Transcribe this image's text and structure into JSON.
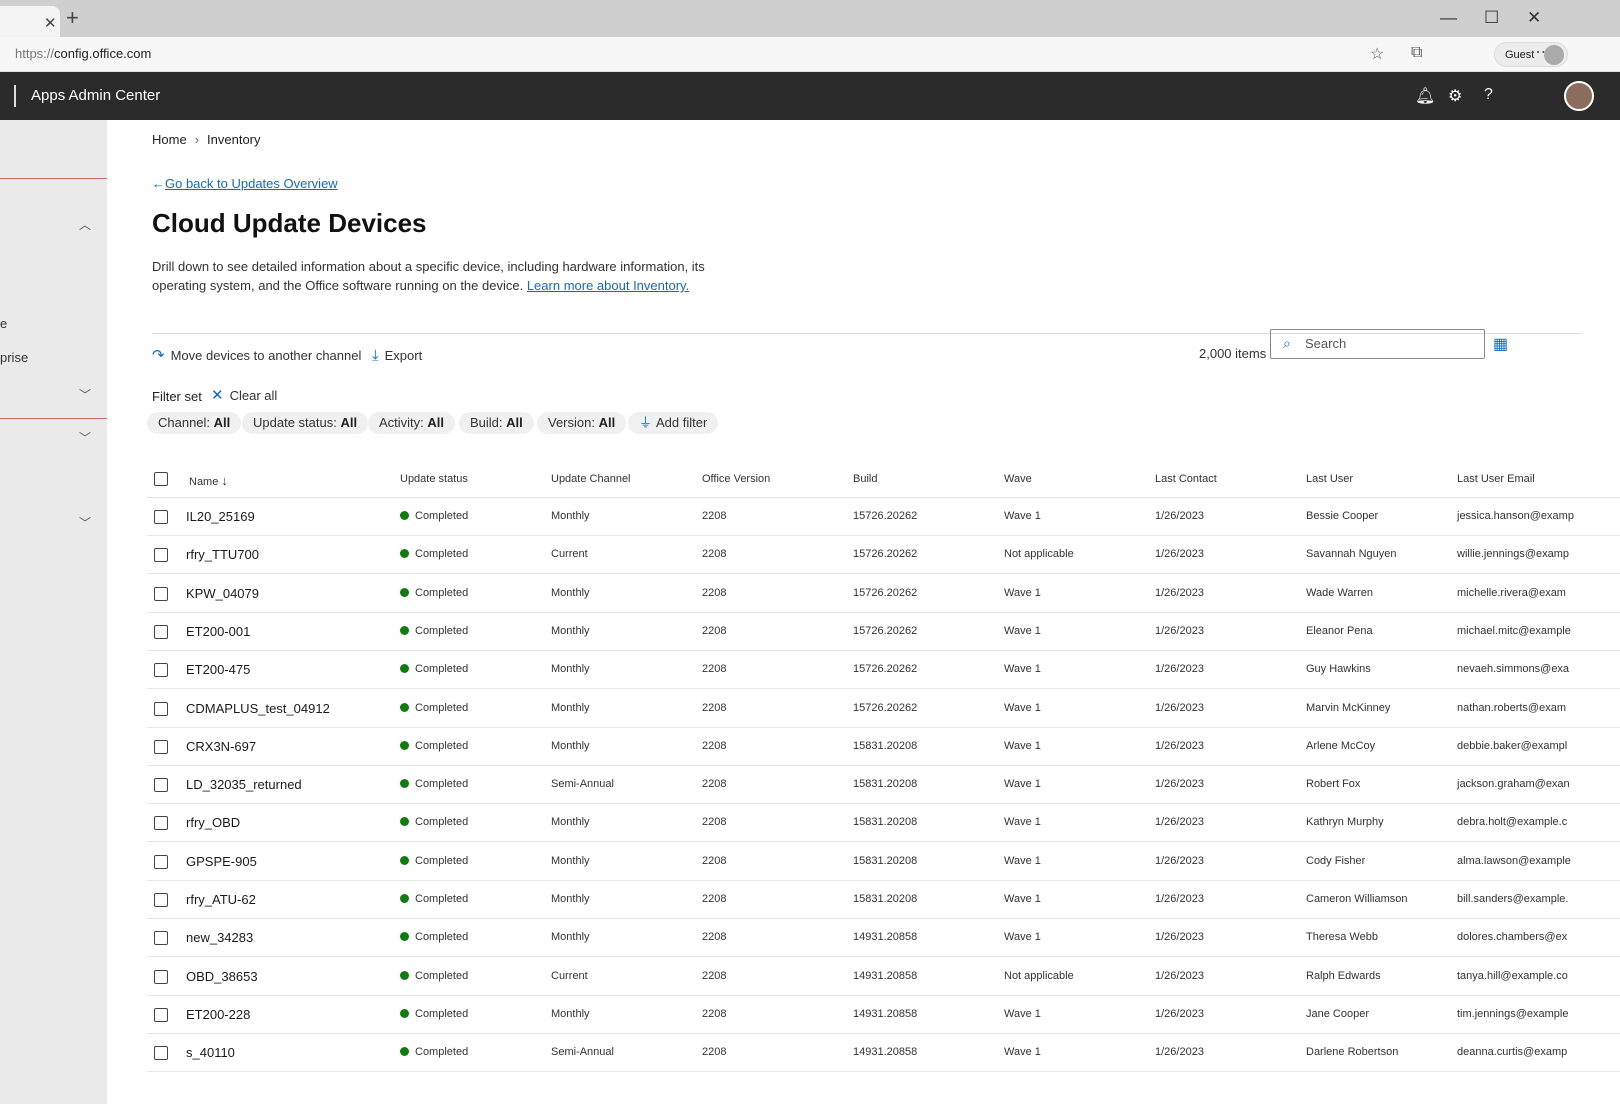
{
  "browser": {
    "url_protocol": "https://",
    "url_host": "config.office.com",
    "profile_label": "Guest",
    "colors": {
      "chrome": "#cfcfcf"
    }
  },
  "header": {
    "title": "Apps Admin Center",
    "icons": [
      "bell-icon",
      "gear-icon",
      "help-icon"
    ]
  },
  "sidebar": {
    "fragments": [
      "e",
      "prise"
    ]
  },
  "breadcrumb": {
    "home": "Home",
    "current": "Inventory"
  },
  "page": {
    "back_link": "Go back to Updates Overview",
    "title": "Cloud Update Devices",
    "description": "Drill down to see detailed information about a specific device, including hardware information, its operating system, and the Office software running on the device.",
    "learn_more": "Learn more about Inventory."
  },
  "toolbar": {
    "move_label": "Move devices to another channel",
    "export_label": "Export",
    "items_count": "2,000 items",
    "search_placeholder": "Search"
  },
  "filters": {
    "label": "Filter set",
    "clear_all": "Clear all",
    "pills": [
      {
        "name": "Channel:",
        "value": "All"
      },
      {
        "name": "Update status:",
        "value": "All"
      },
      {
        "name": "Activity:",
        "value": "All"
      },
      {
        "name": "Build:",
        "value": "All"
      },
      {
        "name": "Version:",
        "value": "All"
      }
    ],
    "add_filter": "Add filter"
  },
  "table": {
    "columns": [
      "Name",
      "Update status",
      "Update Channel",
      "Office Version",
      "Build",
      "Wave",
      "Last Contact",
      "Last User",
      "Last User Email"
    ],
    "status_color": "#107c10",
    "rows": [
      [
        "IL20_25169",
        "Completed",
        "Monthly",
        "2208",
        "15726.20262",
        "Wave 1",
        "1/26/2023",
        "Bessie Cooper",
        "jessica.hanson@examp"
      ],
      [
        "rfry_TTU700",
        "Completed",
        "Current",
        "2208",
        "15726.20262",
        "Not applicable",
        "1/26/2023",
        "Savannah Nguyen",
        "willie.jennings@examp"
      ],
      [
        "KPW_04079",
        "Completed",
        "Monthly",
        "2208",
        "15726.20262",
        "Wave 1",
        "1/26/2023",
        "Wade Warren",
        "michelle.rivera@exam"
      ],
      [
        "ET200-001",
        "Completed",
        "Monthly",
        "2208",
        "15726.20262",
        "Wave 1",
        "1/26/2023",
        "Eleanor Pena",
        "michael.mitc@example"
      ],
      [
        "ET200-475",
        "Completed",
        "Monthly",
        "2208",
        "15726.20262",
        "Wave 1",
        "1/26/2023",
        "Guy Hawkins",
        "nevaeh.simmons@exa"
      ],
      [
        "CDMAPLUS_test_04912",
        "Completed",
        "Monthly",
        "2208",
        "15726.20262",
        "Wave 1",
        "1/26/2023",
        "Marvin McKinney",
        "nathan.roberts@exam"
      ],
      [
        "CRX3N-697",
        "Completed",
        "Monthly",
        "2208",
        "15831.20208",
        "Wave 1",
        "1/26/2023",
        "Arlene McCoy",
        "debbie.baker@exampl"
      ],
      [
        "LD_32035_returned",
        "Completed",
        "Semi-Annual",
        "2208",
        "15831.20208",
        "Wave 1",
        "1/26/2023",
        "Robert Fox",
        "jackson.graham@exan"
      ],
      [
        "rfry_OBD",
        "Completed",
        "Monthly",
        "2208",
        "15831.20208",
        "Wave 1",
        "1/26/2023",
        "Kathryn Murphy",
        "debra.holt@example.c"
      ],
      [
        "GPSPE-905",
        "Completed",
        "Monthly",
        "2208",
        "15831.20208",
        "Wave 1",
        "1/26/2023",
        "Cody Fisher",
        "alma.lawson@example"
      ],
      [
        "rfry_ATU-62",
        "Completed",
        "Monthly",
        "2208",
        "15831.20208",
        "Wave 1",
        "1/26/2023",
        "Cameron Williamson",
        "bill.sanders@example."
      ],
      [
        "new_34283",
        "Completed",
        "Monthly",
        "2208",
        "14931.20858",
        "Wave 1",
        "1/26/2023",
        "Theresa Webb",
        "dolores.chambers@ex"
      ],
      [
        "OBD_38653",
        "Completed",
        "Current",
        "2208",
        "14931.20858",
        "Not applicable",
        "1/26/2023",
        "Ralph Edwards",
        "tanya.hill@example.co"
      ],
      [
        "ET200-228",
        "Completed",
        "Monthly",
        "2208",
        "14931.20858",
        "Wave 1",
        "1/26/2023",
        "Jane Cooper",
        "tim.jennings@example"
      ],
      [
        "s_40110",
        "Completed",
        "Semi-Annual",
        "2208",
        "14931.20858",
        "Wave 1",
        "1/26/2023",
        "Darlene Robertson",
        "deanna.curtis@examp"
      ]
    ]
  }
}
